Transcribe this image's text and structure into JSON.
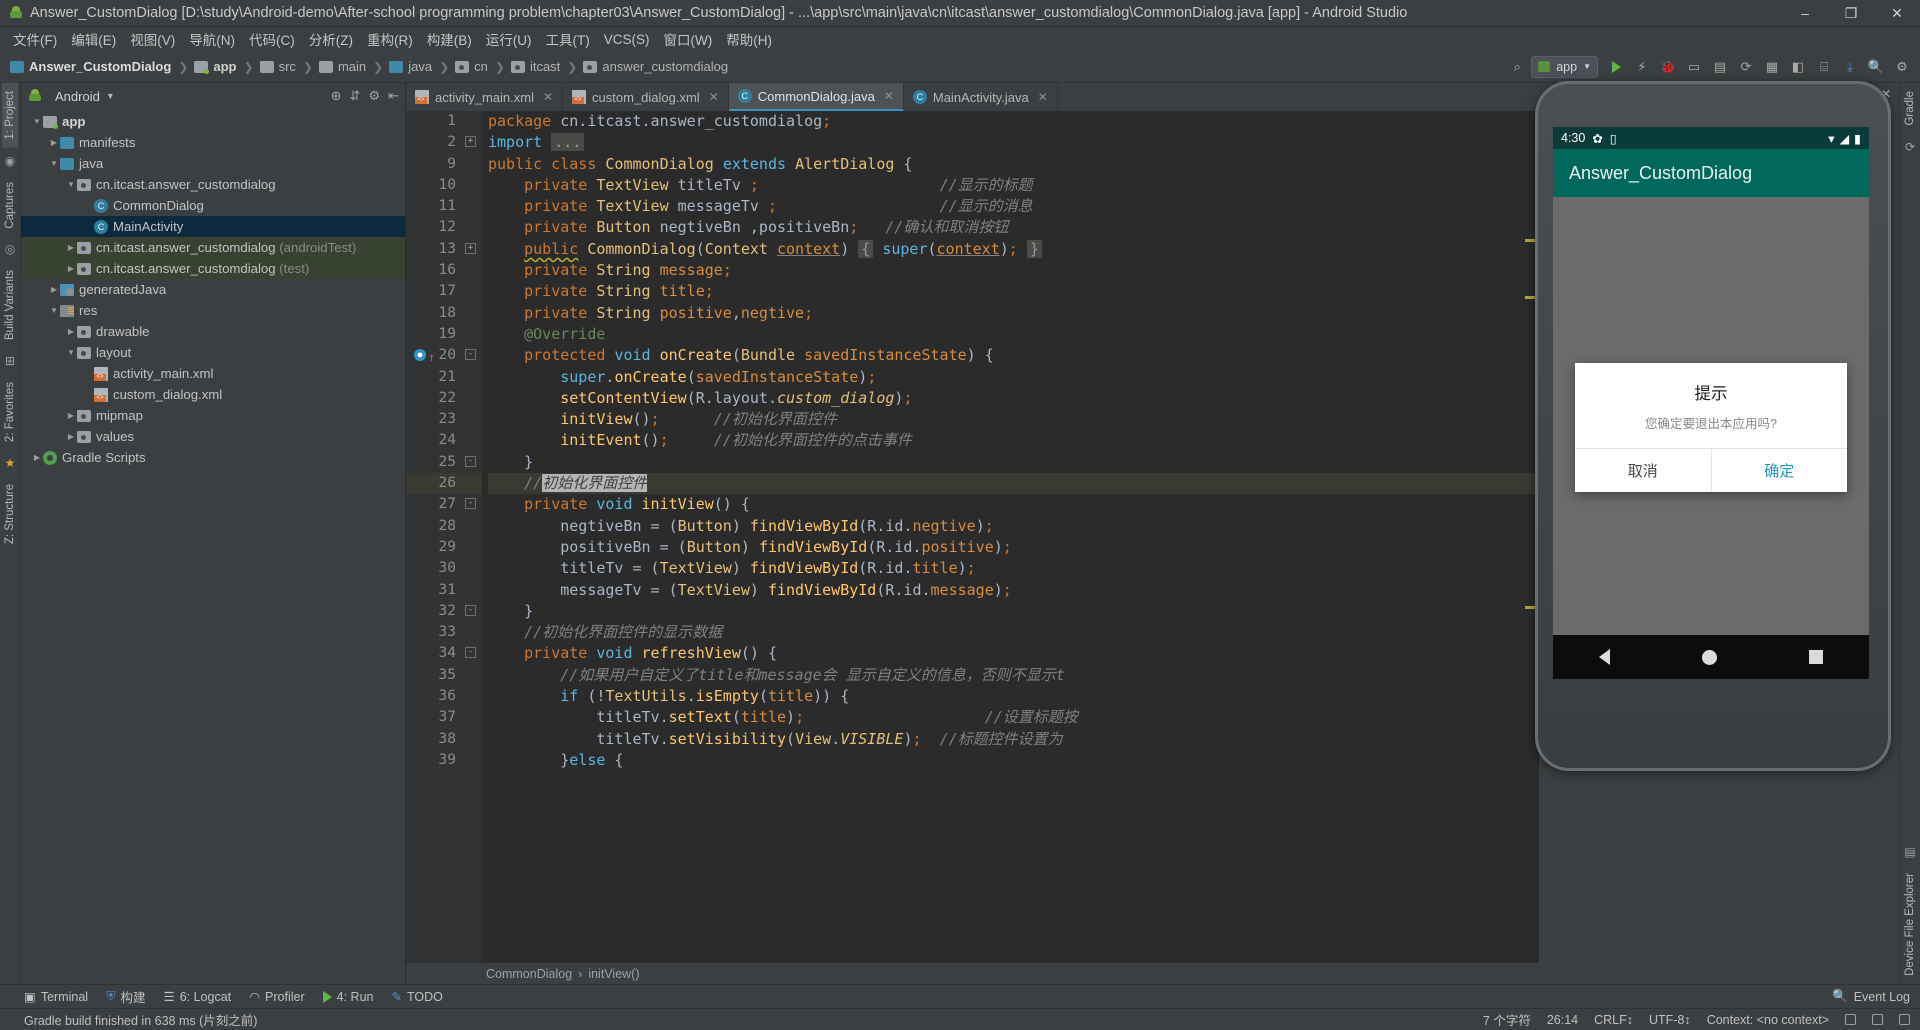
{
  "window": {
    "title": "Answer_CustomDialog [D:\\study\\Android-demo\\After-school programming problem\\chapter03\\Answer_CustomDialog] - ...\\app\\src\\main\\java\\cn\\itcast\\answer_customdialog\\CommonDialog.java [app] - Android Studio",
    "minimize": "–",
    "maximize": "❐",
    "close": "✕"
  },
  "menubar": [
    "文件(F)",
    "编辑(E)",
    "视图(V)",
    "导航(N)",
    "代码(C)",
    "分析(Z)",
    "重构(R)",
    "构建(B)",
    "运行(U)",
    "工具(T)",
    "VCS(S)",
    "窗口(W)",
    "帮助(H)"
  ],
  "breadcrumb": [
    "Answer_CustomDialog",
    "app",
    "src",
    "main",
    "java",
    "cn",
    "itcast",
    "answer_customdialog"
  ],
  "toolbar": {
    "run_config": "app",
    "run_title": "Run",
    "debug_title": "Debug"
  },
  "left_rail": [
    "1: Project",
    "Captures",
    "Build Variants",
    "2: Favorites",
    "Z: Structure"
  ],
  "right_rail": [
    "Gradle",
    "Device File Explorer"
  ],
  "project": {
    "header": "Android",
    "tree": [
      {
        "label": "app",
        "depth": 0,
        "arrow": "▼",
        "icon": "module-folder",
        "bold": true
      },
      {
        "label": "manifests",
        "depth": 1,
        "arrow": "▶",
        "icon": "folder-blue"
      },
      {
        "label": "java",
        "depth": 1,
        "arrow": "▼",
        "icon": "folder-blue"
      },
      {
        "label": "cn.itcast.answer_customdialog",
        "depth": 2,
        "arrow": "▼",
        "icon": "package"
      },
      {
        "label": "CommonDialog",
        "depth": 3,
        "arrow": "",
        "icon": "class"
      },
      {
        "label": "MainActivity",
        "depth": 3,
        "arrow": "",
        "icon": "class",
        "selected": true
      },
      {
        "label": "cn.itcast.answer_customdialog",
        "suffix": " (androidTest)",
        "depth": 2,
        "arrow": "▶",
        "icon": "package",
        "test": true
      },
      {
        "label": "cn.itcast.answer_customdialog",
        "suffix": " (test)",
        "depth": 2,
        "arrow": "▶",
        "icon": "package",
        "test": true
      },
      {
        "label": "generatedJava",
        "depth": 1,
        "arrow": "▶",
        "icon": "generated"
      },
      {
        "label": "res",
        "depth": 1,
        "arrow": "▼",
        "icon": "res"
      },
      {
        "label": "drawable",
        "depth": 2,
        "arrow": "▶",
        "icon": "package"
      },
      {
        "label": "layout",
        "depth": 2,
        "arrow": "▼",
        "icon": "package"
      },
      {
        "label": "activity_main.xml",
        "depth": 3,
        "arrow": "",
        "icon": "xml"
      },
      {
        "label": "custom_dialog.xml",
        "depth": 3,
        "arrow": "",
        "icon": "xml"
      },
      {
        "label": "mipmap",
        "depth": 2,
        "arrow": "▶",
        "icon": "package"
      },
      {
        "label": "values",
        "depth": 2,
        "arrow": "▶",
        "icon": "package"
      },
      {
        "label": "Gradle Scripts",
        "depth": 0,
        "arrow": "▶",
        "icon": "gradle"
      }
    ]
  },
  "editor": {
    "tabs": [
      {
        "label": "activity_main.xml",
        "icon": "xml",
        "active": false
      },
      {
        "label": "custom_dialog.xml",
        "icon": "xml",
        "active": false
      },
      {
        "label": "CommonDialog.java",
        "icon": "class",
        "active": true
      },
      {
        "label": "MainActivity.java",
        "icon": "class",
        "active": false
      }
    ],
    "line_numbers": [
      1,
      2,
      9,
      10,
      11,
      12,
      13,
      16,
      17,
      18,
      19,
      20,
      21,
      22,
      23,
      24,
      25,
      26,
      27,
      28,
      29,
      30,
      31,
      32,
      33,
      34,
      35,
      36,
      37,
      38,
      39
    ],
    "breadcrumb": [
      "CommonDialog",
      "initView()"
    ]
  },
  "code_lines": [
    "package cn.itcast.answer_customdialog;",
    "import ...",
    "public class CommonDialog extends AlertDialog {",
    "    private TextView titleTv ;                    //显示的标题",
    "    private TextView messageTv ;                  //显示的消息",
    "    private Button negtiveBn ,positiveBn;   //确认和取消按钮",
    "    public CommonDialog(Context context) { super(context); }",
    "    private String message;",
    "    private String title;",
    "    private String positive,negtive;",
    "    @Override",
    "    protected void onCreate(Bundle savedInstanceState) {",
    "        super.onCreate(savedInstanceState);",
    "        setContentView(R.layout.custom_dialog);",
    "        initView();      //初始化界面控件",
    "        initEvent();     //初始化界面控件的点击事件",
    "    }",
    "    //初始化界面控件",
    "    private void initView() {",
    "        negtiveBn = (Button) findViewById(R.id.negtive);",
    "        positiveBn = (Button) findViewById(R.id.positive);",
    "        titleTv = (TextView) findViewById(R.id.title);",
    "        messageTv = (TextView) findViewById(R.id.message);",
    "    }",
    "    //初始化界面控件的显示数据",
    "    private void refreshView() {",
    "        //如果用户自定义了title和message会 显示自定义的信息，否则不显示t",
    "        if (!TextUtils.isEmpty(title)) {",
    "            titleTv.setText(title);                    //设置标题按",
    "            titleTv.setVisibility(View.VISIBLE);  //标题控件设置为",
    "        }else {"
  ],
  "emulator": {
    "window_minimize": "–",
    "window_close": "✕",
    "status_time": "4:30",
    "app_title": "Answer_CustomDialog",
    "dialog": {
      "title": "提示",
      "message": "您确定要退出本应用吗?",
      "negative": "取消",
      "positive": "确定"
    },
    "side_buttons": [
      "power-icon",
      "volume-up-icon",
      "volume-down-icon",
      "rotate-left-icon",
      "rotate-right-icon",
      "camera-icon",
      "zoom-icon",
      "back-icon",
      "home-icon",
      "overview-icon",
      "more-icon"
    ]
  },
  "bottom_strip": [
    {
      "label": "Terminal",
      "icon": "terminal-icon"
    },
    {
      "label": "构建",
      "icon": "build-icon"
    },
    {
      "label": "6: Logcat",
      "icon": "logcat-icon"
    },
    {
      "label": "Profiler",
      "icon": "profiler-icon"
    },
    {
      "label": "4: Run",
      "icon": "run-icon"
    },
    {
      "label": "TODO",
      "icon": "todo-icon"
    }
  ],
  "bottom_right": "Event Log",
  "statusbar": {
    "message": "Gradle build finished in 638 ms (片刻之前)",
    "chars": "7 个字符",
    "caret": "26:14",
    "line_sep": "CRLF↕",
    "encoding": "UTF-8↕",
    "context": "Context: <no context>"
  }
}
